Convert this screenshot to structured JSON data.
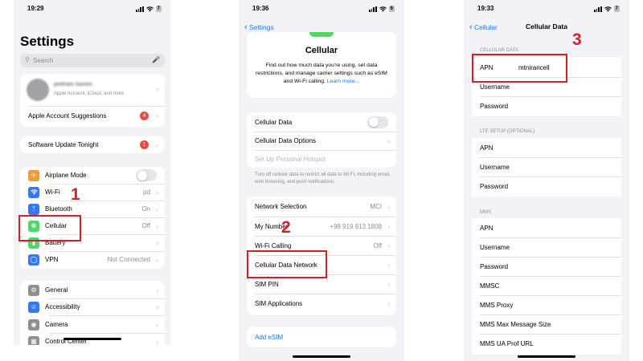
{
  "screen1": {
    "time": "19:29",
    "battery": "7",
    "title": "Settings",
    "search_placeholder": "Search",
    "profile": {
      "name": "pedram karimi",
      "subtitle": "Apple Account, iCloud, and more"
    },
    "suggestions": {
      "label": "Apple Account Suggestions",
      "badge": "4"
    },
    "software_update": {
      "label": "Software Update Tonight",
      "badge": "1"
    },
    "rows": [
      {
        "label": "Airplane Mode",
        "value": "",
        "icon": "airplane-icon",
        "color": "#f19a37"
      },
      {
        "label": "Wi-Fi",
        "value": "pd",
        "icon": "wifi-icon",
        "color": "#3478f6"
      },
      {
        "label": "Bluetooth",
        "value": "On",
        "icon": "bluetooth-icon",
        "color": "#3478f6"
      },
      {
        "label": "Cellular",
        "value": "Off",
        "icon": "antenna-icon",
        "color": "#4cd964"
      },
      {
        "label": "Battery",
        "value": "",
        "icon": "battery-icon",
        "color": "#4cd964"
      },
      {
        "label": "VPN",
        "value": "Not Connected",
        "icon": "globe-icon",
        "color": "#3478f6"
      }
    ],
    "rows2": [
      {
        "label": "General",
        "icon": "gear-icon",
        "color": "#8e8e93"
      },
      {
        "label": "Accessibility",
        "icon": "accessibility-icon",
        "color": "#3478f6"
      },
      {
        "label": "Camera",
        "icon": "camera-icon",
        "color": "#8e8e93"
      },
      {
        "label": "Control Center",
        "icon": "control-center-icon",
        "color": "#8e8e93"
      }
    ],
    "step": "1"
  },
  "screen2": {
    "time": "19:36",
    "battery": "6",
    "back": "Settings",
    "title": "Cellular",
    "description": "Find out how much data you're using, set data restrictions, and manage carrier settings such as eSIM and Wi-Fi calling.",
    "learn_more": "Learn more...",
    "cellular_data": "Cellular Data",
    "cellular_data_options": "Cellular Data Options",
    "personal_hotspot": "Set Up Personal Hotspot",
    "footer": "Turn off cellular data to restrict all data to Wi-Fi, including email, web browsing, and push notifications.",
    "rows": [
      {
        "label": "Network Selection",
        "value": "MCI"
      },
      {
        "label": "My Number",
        "value": "+98 919 913 1808"
      },
      {
        "label": "Wi-Fi Calling",
        "value": "Off"
      },
      {
        "label": "Cellular Data Network",
        "value": ""
      },
      {
        "label": "SIM PIN",
        "value": ""
      },
      {
        "label": "SIM Applications",
        "value": ""
      }
    ],
    "add_esim": "Add eSIM",
    "step": "2"
  },
  "screen3": {
    "time": "19:33",
    "battery": "7",
    "back": "Cellular",
    "title": "Cellular Data",
    "section1": "CELLULAR DATA",
    "apn_label": "APN",
    "apn_value": "mtnirancell",
    "username": "Username",
    "password": "Password",
    "section2": "LTE SETUP (OPTIONAL)",
    "lte_rows": [
      "APN",
      "Username",
      "Password"
    ],
    "section3": "MMS",
    "mms_rows": [
      "APN",
      "Username",
      "Password",
      "MMSC",
      "MMS Proxy",
      "MMS Max Message Size",
      "MMS UA Prof URL"
    ],
    "step": "3"
  }
}
